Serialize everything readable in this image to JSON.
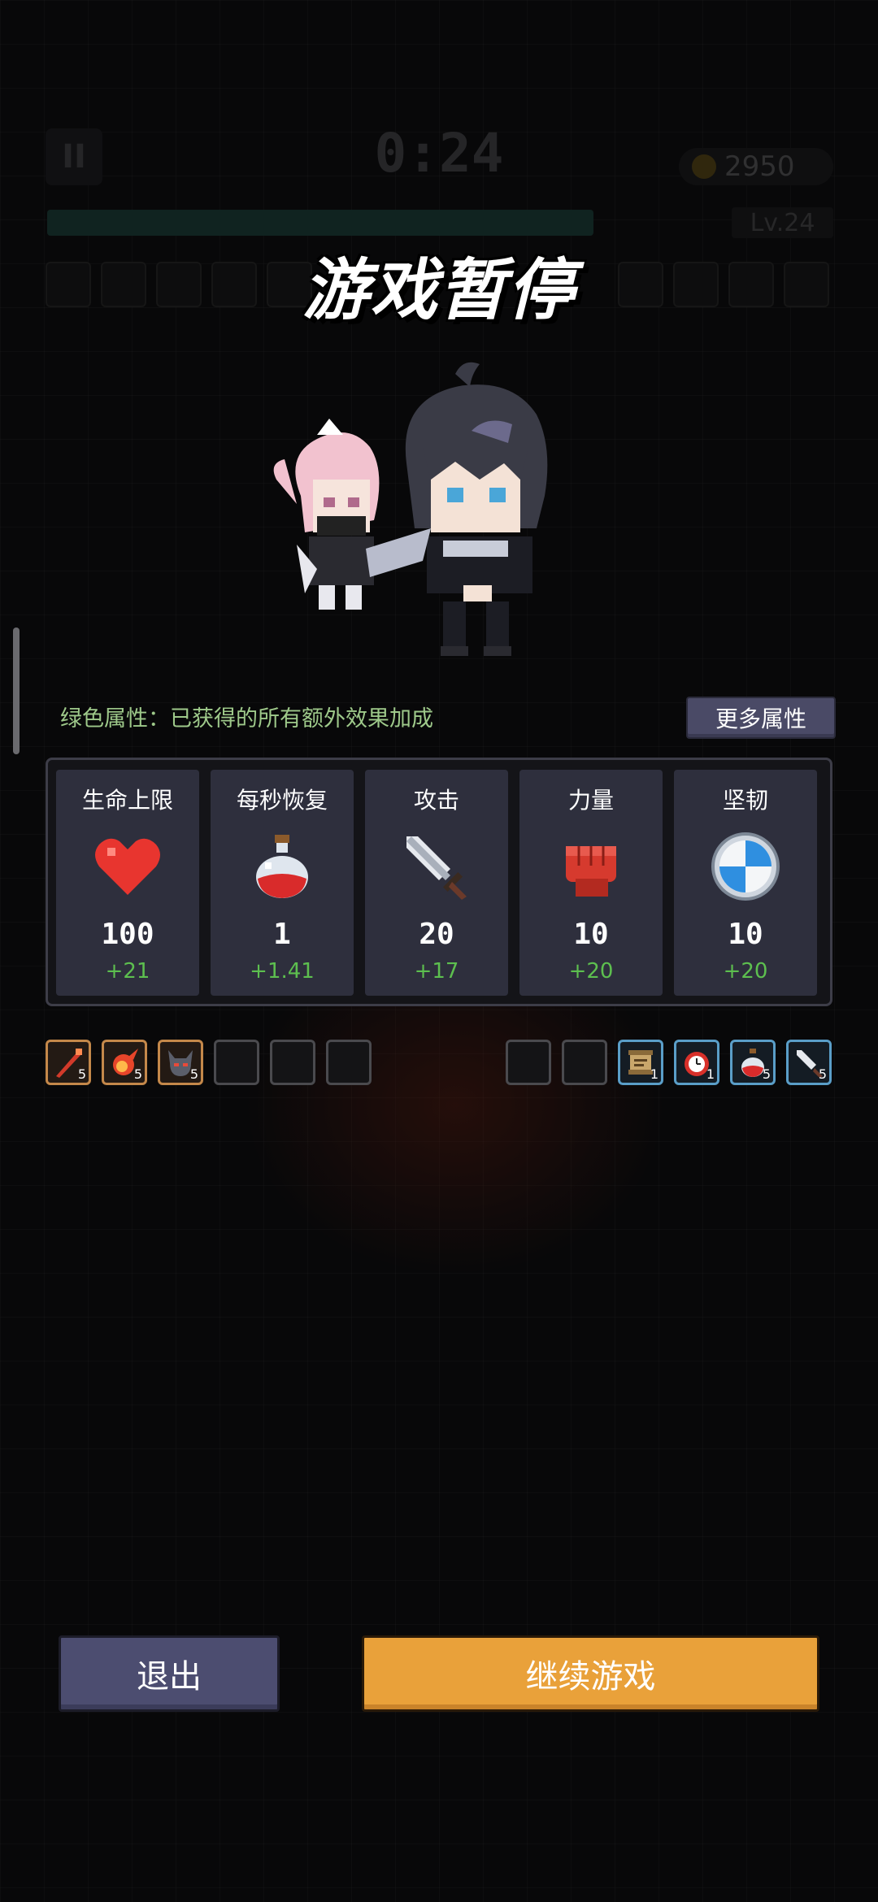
{
  "hud": {
    "pause_icon": "pause-icon",
    "timer": "0:24",
    "coins": "2950",
    "level": "Lv.24"
  },
  "title": "游戏暂停",
  "hint": "绿色属性：已获得的所有额外效果加成",
  "more_stats_label": "更多属性",
  "stats": [
    {
      "label": "生命上限",
      "value": "100",
      "bonus": "+21",
      "icon": "heart-icon"
    },
    {
      "label": "每秒恢复",
      "value": "1",
      "bonus": "+1.41",
      "icon": "potion-icon"
    },
    {
      "label": "攻击",
      "value": "20",
      "bonus": "+17",
      "icon": "sword-icon"
    },
    {
      "label": "力量",
      "value": "10",
      "bonus": "+20",
      "icon": "fist-icon"
    },
    {
      "label": "坚韧",
      "value": "10",
      "bonus": "+20",
      "icon": "shield-icon"
    }
  ],
  "weapons": [
    {
      "icon": "red-staff-icon",
      "level": "5"
    },
    {
      "icon": "fireball-icon",
      "level": "5"
    },
    {
      "icon": "demon-helmet-icon",
      "level": "5"
    }
  ],
  "passives": [
    {
      "icon": "scroll-icon",
      "level": "1"
    },
    {
      "icon": "alarm-clock-icon",
      "level": "1"
    },
    {
      "icon": "potion-icon",
      "level": "5"
    },
    {
      "icon": "sword-icon",
      "level": "5"
    }
  ],
  "buttons": {
    "exit": "退出",
    "continue": "继续游戏"
  },
  "colors": {
    "bonus": "#5dbf4f",
    "continue_button": "#e9a13a",
    "exit_button": "#4c4d70",
    "weapon_border": "#c4884a",
    "passive_border": "#5a9ec8"
  }
}
